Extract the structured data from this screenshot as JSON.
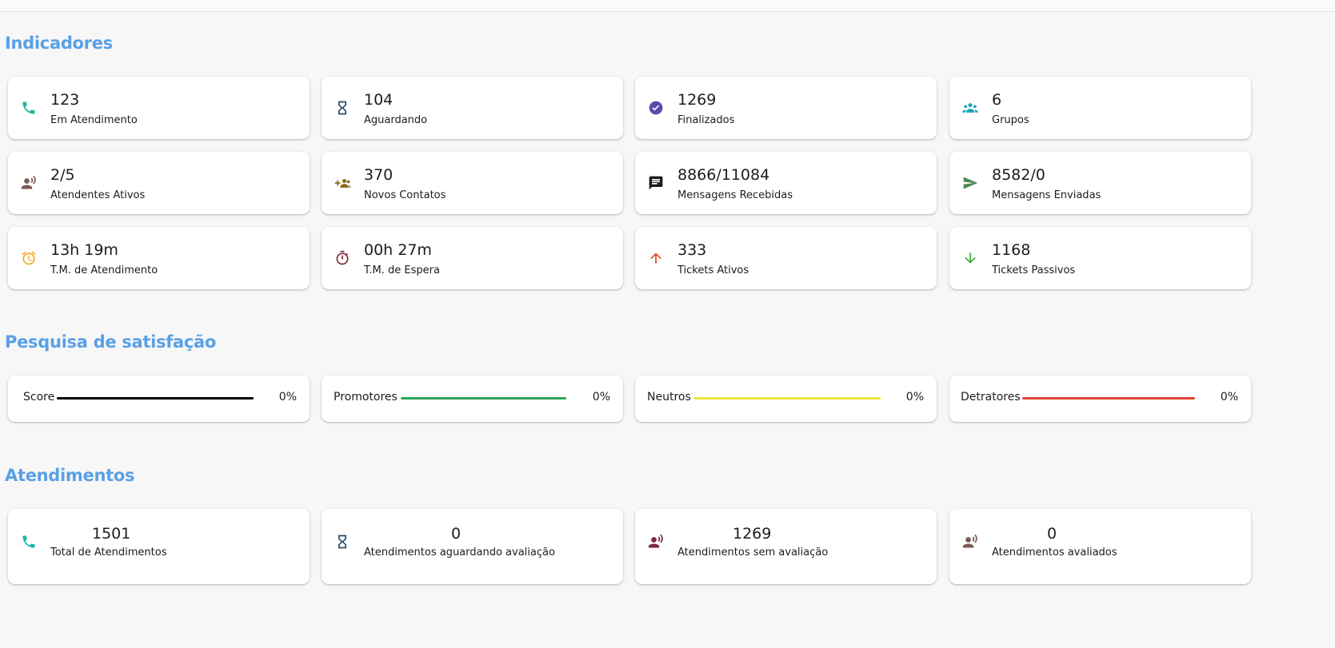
{
  "sections": {
    "indicators_title": "Indicadores",
    "satisfaction_title": "Pesquisa de satisfação",
    "attendances_title": "Atendimentos"
  },
  "indicators": [
    {
      "value": "123",
      "label": "Em Atendimento",
      "icon": "phone-icon",
      "color": "#1bb7a7"
    },
    {
      "value": "104",
      "label": "Aguardando",
      "icon": "hourglass-icon",
      "color": "#2a4a66"
    },
    {
      "value": "1269",
      "label": "Finalizados",
      "icon": "check-circle-icon",
      "color": "#5b4aa8"
    },
    {
      "value": "6",
      "label": "Grupos",
      "icon": "groups-icon",
      "color": "#16a6b6"
    },
    {
      "value": "2/5",
      "label": "Atendentes Ativos",
      "icon": "record-voice-icon",
      "color": "#7a5a55"
    },
    {
      "value": "370",
      "label": "Novos Contatos",
      "icon": "group-add-icon",
      "color": "#8a6a12"
    },
    {
      "value": "8866/11084",
      "label": "Mensagens Recebidas",
      "icon": "chat-icon",
      "color": "#1c1c1c"
    },
    {
      "value": "8582/0",
      "label": "Mensagens Enviadas",
      "icon": "send-icon",
      "color": "#4a8a5a"
    },
    {
      "value": "13h 19m",
      "label": "T.M. de Atendimento",
      "icon": "alarm-icon",
      "color": "#f5a623"
    },
    {
      "value": "00h 27m",
      "label": "T.M. de Espera",
      "icon": "timer-icon",
      "color": "#7a2a3a"
    },
    {
      "value": "333",
      "label": "Tickets Ativos",
      "icon": "arrow-up-icon",
      "color": "#e2452a"
    },
    {
      "value": "1168",
      "label": "Tickets Passivos",
      "icon": "arrow-down-icon",
      "color": "#3aaa3a"
    }
  ],
  "satisfaction": [
    {
      "label": "Score",
      "percent": "0%",
      "color": "#000000"
    },
    {
      "label": "Promotores",
      "percent": "0%",
      "color": "#2ea65a"
    },
    {
      "label": "Neutros",
      "percent": "0%",
      "color": "#f2e43a"
    },
    {
      "label": "Detratores",
      "percent": "0%",
      "color": "#e2453a"
    }
  ],
  "attendances": [
    {
      "value": "1501",
      "label": "Total de Atendimentos",
      "icon": "phone-icon",
      "color": "#1bb7a7"
    },
    {
      "value": "0",
      "label": "Atendimentos aguardando avaliação",
      "icon": "hourglass-icon",
      "color": "#2a4a66"
    },
    {
      "value": "1269",
      "label": "Atendimentos sem avaliação",
      "icon": "record-voice-icon",
      "color": "#7a2a3a"
    },
    {
      "value": "0",
      "label": "Atendimentos avaliados",
      "icon": "record-voice-icon",
      "color": "#7a5a55"
    }
  ]
}
